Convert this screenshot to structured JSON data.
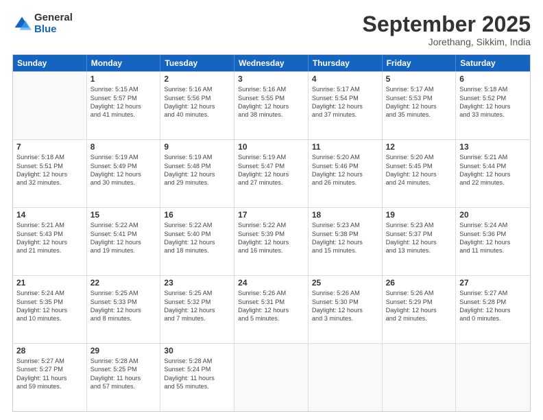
{
  "header": {
    "logo_general": "General",
    "logo_blue": "Blue",
    "month_title": "September 2025",
    "location": "Jorethang, Sikkim, India"
  },
  "weekdays": [
    "Sunday",
    "Monday",
    "Tuesday",
    "Wednesday",
    "Thursday",
    "Friday",
    "Saturday"
  ],
  "weeks": [
    [
      {
        "day": "",
        "info": ""
      },
      {
        "day": "1",
        "info": "Sunrise: 5:15 AM\nSunset: 5:57 PM\nDaylight: 12 hours\nand 41 minutes."
      },
      {
        "day": "2",
        "info": "Sunrise: 5:16 AM\nSunset: 5:56 PM\nDaylight: 12 hours\nand 40 minutes."
      },
      {
        "day": "3",
        "info": "Sunrise: 5:16 AM\nSunset: 5:55 PM\nDaylight: 12 hours\nand 38 minutes."
      },
      {
        "day": "4",
        "info": "Sunrise: 5:17 AM\nSunset: 5:54 PM\nDaylight: 12 hours\nand 37 minutes."
      },
      {
        "day": "5",
        "info": "Sunrise: 5:17 AM\nSunset: 5:53 PM\nDaylight: 12 hours\nand 35 minutes."
      },
      {
        "day": "6",
        "info": "Sunrise: 5:18 AM\nSunset: 5:52 PM\nDaylight: 12 hours\nand 33 minutes."
      }
    ],
    [
      {
        "day": "7",
        "info": "Sunrise: 5:18 AM\nSunset: 5:51 PM\nDaylight: 12 hours\nand 32 minutes."
      },
      {
        "day": "8",
        "info": "Sunrise: 5:19 AM\nSunset: 5:49 PM\nDaylight: 12 hours\nand 30 minutes."
      },
      {
        "day": "9",
        "info": "Sunrise: 5:19 AM\nSunset: 5:48 PM\nDaylight: 12 hours\nand 29 minutes."
      },
      {
        "day": "10",
        "info": "Sunrise: 5:19 AM\nSunset: 5:47 PM\nDaylight: 12 hours\nand 27 minutes."
      },
      {
        "day": "11",
        "info": "Sunrise: 5:20 AM\nSunset: 5:46 PM\nDaylight: 12 hours\nand 26 minutes."
      },
      {
        "day": "12",
        "info": "Sunrise: 5:20 AM\nSunset: 5:45 PM\nDaylight: 12 hours\nand 24 minutes."
      },
      {
        "day": "13",
        "info": "Sunrise: 5:21 AM\nSunset: 5:44 PM\nDaylight: 12 hours\nand 22 minutes."
      }
    ],
    [
      {
        "day": "14",
        "info": "Sunrise: 5:21 AM\nSunset: 5:43 PM\nDaylight: 12 hours\nand 21 minutes."
      },
      {
        "day": "15",
        "info": "Sunrise: 5:22 AM\nSunset: 5:41 PM\nDaylight: 12 hours\nand 19 minutes."
      },
      {
        "day": "16",
        "info": "Sunrise: 5:22 AM\nSunset: 5:40 PM\nDaylight: 12 hours\nand 18 minutes."
      },
      {
        "day": "17",
        "info": "Sunrise: 5:22 AM\nSunset: 5:39 PM\nDaylight: 12 hours\nand 16 minutes."
      },
      {
        "day": "18",
        "info": "Sunrise: 5:23 AM\nSunset: 5:38 PM\nDaylight: 12 hours\nand 15 minutes."
      },
      {
        "day": "19",
        "info": "Sunrise: 5:23 AM\nSunset: 5:37 PM\nDaylight: 12 hours\nand 13 minutes."
      },
      {
        "day": "20",
        "info": "Sunrise: 5:24 AM\nSunset: 5:36 PM\nDaylight: 12 hours\nand 11 minutes."
      }
    ],
    [
      {
        "day": "21",
        "info": "Sunrise: 5:24 AM\nSunset: 5:35 PM\nDaylight: 12 hours\nand 10 minutes."
      },
      {
        "day": "22",
        "info": "Sunrise: 5:25 AM\nSunset: 5:33 PM\nDaylight: 12 hours\nand 8 minutes."
      },
      {
        "day": "23",
        "info": "Sunrise: 5:25 AM\nSunset: 5:32 PM\nDaylight: 12 hours\nand 7 minutes."
      },
      {
        "day": "24",
        "info": "Sunrise: 5:26 AM\nSunset: 5:31 PM\nDaylight: 12 hours\nand 5 minutes."
      },
      {
        "day": "25",
        "info": "Sunrise: 5:26 AM\nSunset: 5:30 PM\nDaylight: 12 hours\nand 3 minutes."
      },
      {
        "day": "26",
        "info": "Sunrise: 5:26 AM\nSunset: 5:29 PM\nDaylight: 12 hours\nand 2 minutes."
      },
      {
        "day": "27",
        "info": "Sunrise: 5:27 AM\nSunset: 5:28 PM\nDaylight: 12 hours\nand 0 minutes."
      }
    ],
    [
      {
        "day": "28",
        "info": "Sunrise: 5:27 AM\nSunset: 5:27 PM\nDaylight: 11 hours\nand 59 minutes."
      },
      {
        "day": "29",
        "info": "Sunrise: 5:28 AM\nSunset: 5:25 PM\nDaylight: 11 hours\nand 57 minutes."
      },
      {
        "day": "30",
        "info": "Sunrise: 5:28 AM\nSunset: 5:24 PM\nDaylight: 11 hours\nand 55 minutes."
      },
      {
        "day": "",
        "info": ""
      },
      {
        "day": "",
        "info": ""
      },
      {
        "day": "",
        "info": ""
      },
      {
        "day": "",
        "info": ""
      }
    ]
  ]
}
